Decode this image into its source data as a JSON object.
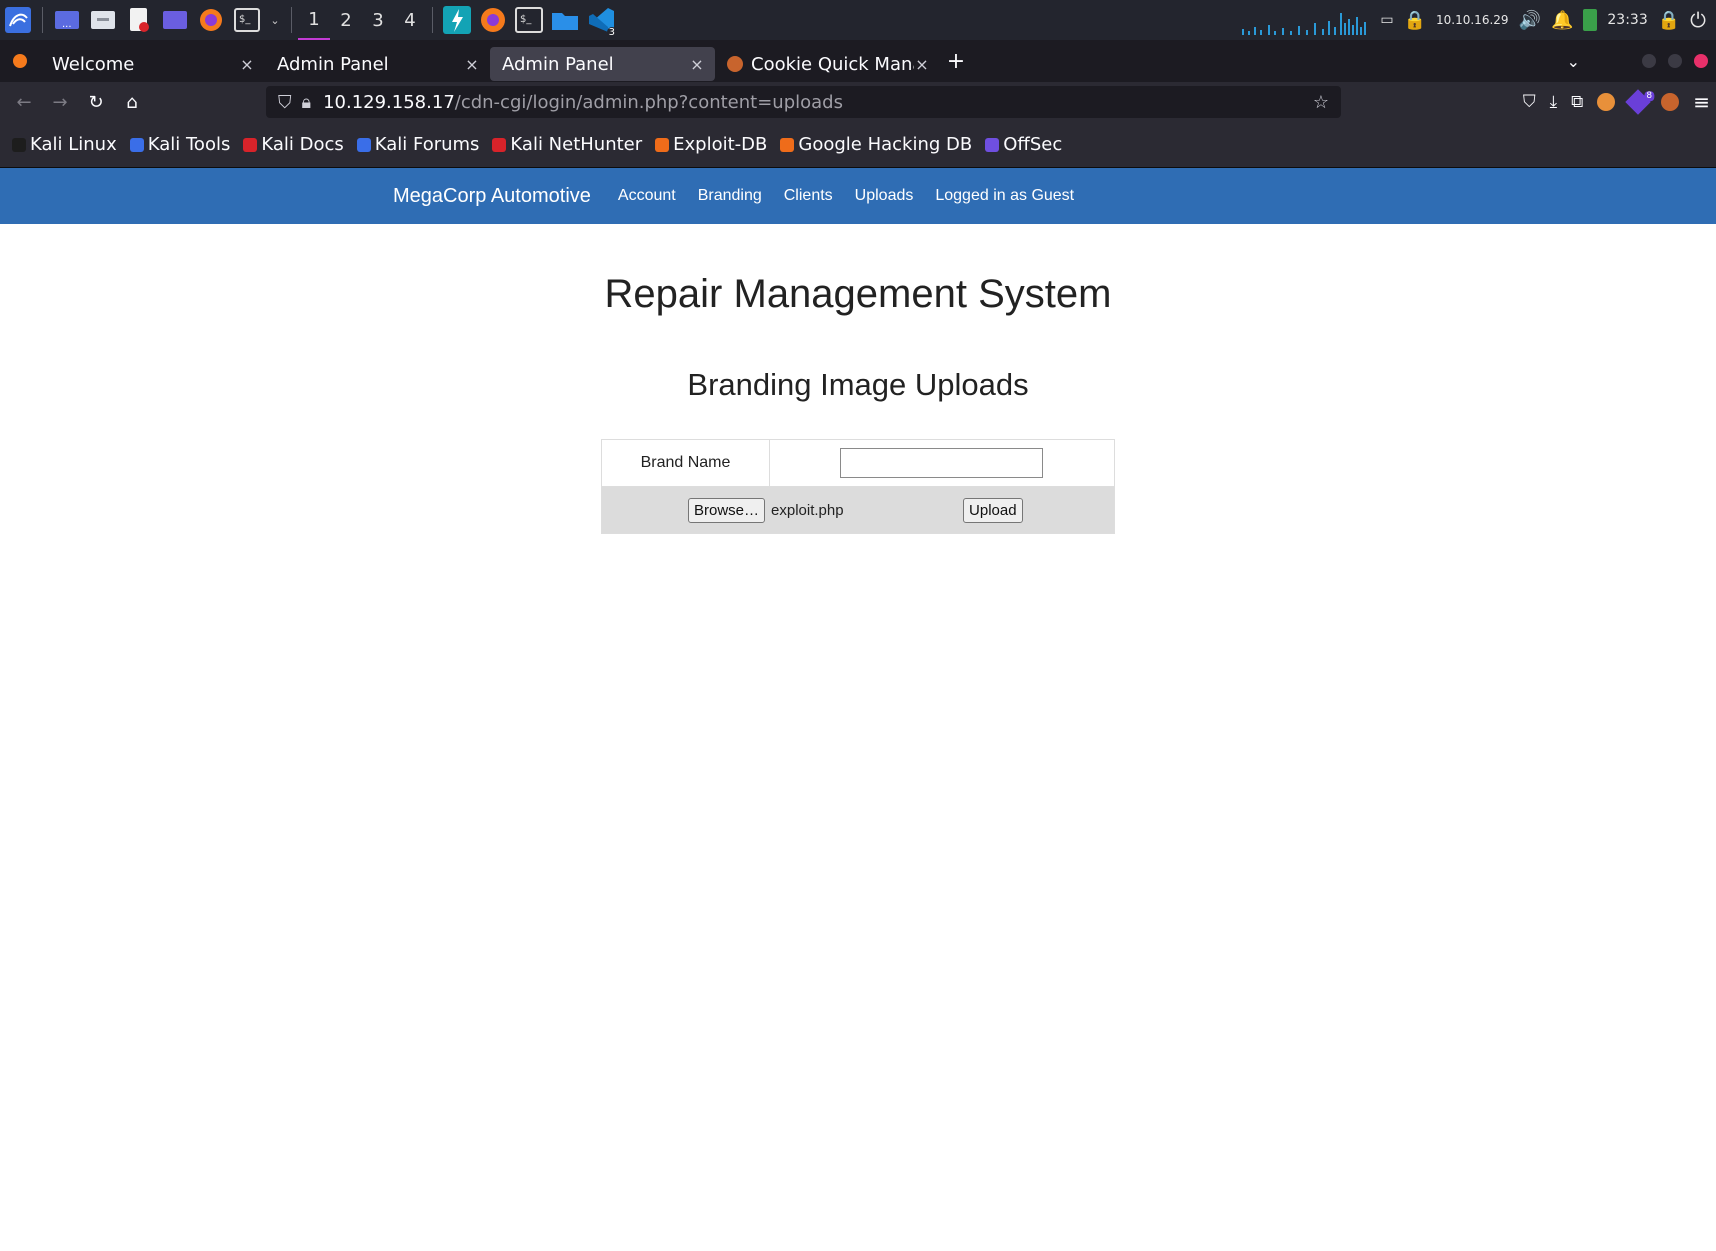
{
  "taskbar": {
    "workspaces": [
      "1",
      "2",
      "3",
      "4"
    ],
    "ip": "10.10.16.29",
    "clock": "23:33",
    "vscode_badge": "3"
  },
  "tabs": [
    {
      "label": "Welcome",
      "close": "×"
    },
    {
      "label": "Admin Panel",
      "close": "×"
    },
    {
      "label": "Admin Panel",
      "close": "×"
    },
    {
      "label": "Cookie Quick Manag",
      "close": "×"
    }
  ],
  "new_tab": "+",
  "address": {
    "host": "10.129.158.17",
    "path": "/cdn-cgi/login/admin.php?content=uploads"
  },
  "extension_badge": "8",
  "bookmarks": [
    {
      "label": "Kali Linux",
      "color": "#1d1d1d"
    },
    {
      "label": "Kali Tools",
      "color": "#3a6ee8"
    },
    {
      "label": "Kali Docs",
      "color": "#d8232a"
    },
    {
      "label": "Kali Forums",
      "color": "#3a6ee8"
    },
    {
      "label": "Kali NetHunter",
      "color": "#d8232a"
    },
    {
      "label": "Exploit-DB",
      "color": "#ef6c1a"
    },
    {
      "label": "Google Hacking DB",
      "color": "#ef6c1a"
    },
    {
      "label": "OffSec",
      "color": "#6f4fe0"
    }
  ],
  "site": {
    "brand": "MegaCorp Automotive",
    "links": [
      "Account",
      "Branding",
      "Clients",
      "Uploads",
      "Logged in as Guest"
    ],
    "title": "Repair Management System",
    "subtitle": "Branding Image Uploads",
    "form": {
      "brand_label": "Brand Name",
      "brand_value": "",
      "browse_label": "Browse…",
      "file_name": "exploit.php",
      "upload_label": "Upload"
    }
  },
  "colors": {
    "site_nav": "#2f6db4",
    "taskbar": "#23252e",
    "browser_chrome": "#2b2a33"
  }
}
